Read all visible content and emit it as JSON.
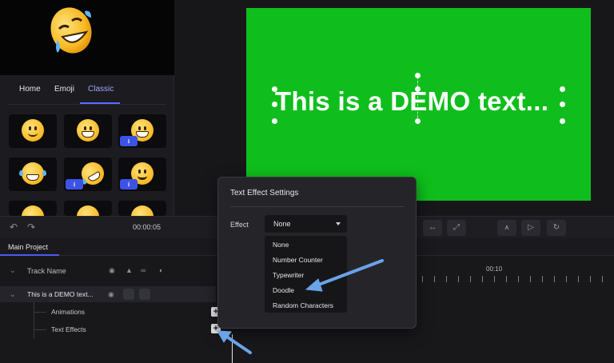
{
  "left_panel": {
    "tabs": [
      "Home",
      "Emoji",
      "Classic"
    ],
    "active_tab": "Classic",
    "download_glyph": "⭳"
  },
  "stage": {
    "demo_text": "This is a DEMO text...",
    "canvas_color": "#0fbe1c"
  },
  "toolbar": {
    "timecode": "00:00:05",
    "undo_icon": "↶",
    "redo_icon": "↷",
    "swap_icon": "↔",
    "expand_icon": "⤢",
    "split_icon": "⩚",
    "play_icon": "▷",
    "reload_icon": "↻"
  },
  "timeline": {
    "project_tab": "Main Project",
    "track_name_header": "Track Name",
    "track_title": "This is a DEMO text...",
    "sub_rows": [
      "Animations",
      "Text Effects"
    ],
    "ruler_time": "00:10",
    "add_symbol": "+",
    "chevron": "⌄",
    "eye_icon": "◉",
    "lock_icon": "▲",
    "link_icon": "∞",
    "audio_icon": "◖"
  },
  "dialog": {
    "title": "Text Effect Settings",
    "effect_label": "Effect",
    "selected": "None",
    "options": [
      "None",
      "Number Counter",
      "Typewriter",
      "Doodle",
      "Random Characters"
    ]
  },
  "colors": {
    "accent": "#4a5cf0",
    "arrow": "#6aa3e8"
  }
}
